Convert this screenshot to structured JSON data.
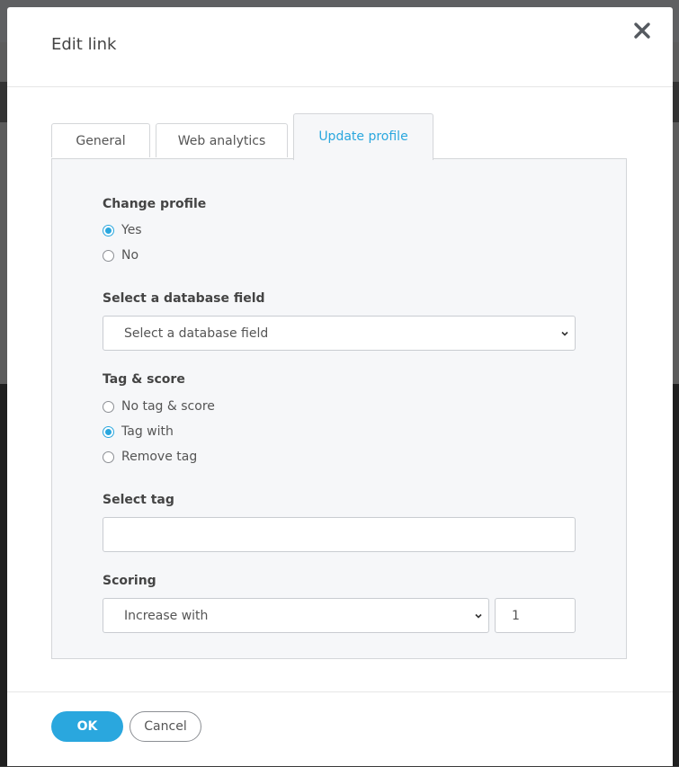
{
  "dialog": {
    "title": "Edit link"
  },
  "tabs": [
    {
      "label": "General"
    },
    {
      "label": "Web analytics"
    },
    {
      "label": "Update profile",
      "active": true
    }
  ],
  "change_profile": {
    "label": "Change profile",
    "options": [
      {
        "label": "Yes",
        "checked": true
      },
      {
        "label": "No",
        "checked": false
      }
    ]
  },
  "database_field": {
    "label": "Select a database field",
    "selected": "Select a database field"
  },
  "tag_score": {
    "label": "Tag & score",
    "options": [
      {
        "label": "No tag & score",
        "checked": false
      },
      {
        "label": "Tag with",
        "checked": true
      },
      {
        "label": "Remove tag",
        "checked": false
      }
    ]
  },
  "select_tag": {
    "label": "Select tag",
    "value": ""
  },
  "scoring": {
    "label": "Scoring",
    "selected": "Increase with",
    "amount": "1"
  },
  "footer": {
    "ok_label": "OK",
    "cancel_label": "Cancel"
  },
  "colors": {
    "accent": "#2aa7de",
    "panel_bg": "#f6f7f9"
  }
}
